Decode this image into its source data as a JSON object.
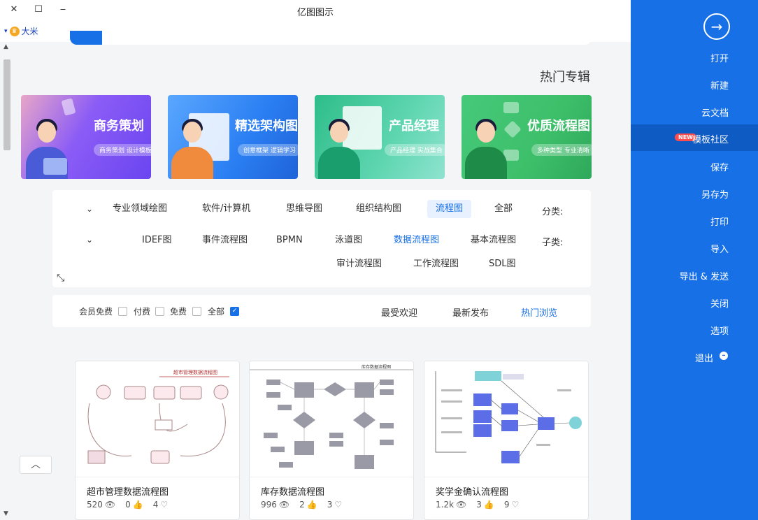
{
  "window": {
    "title": "亿图图示",
    "close_icon": "✕",
    "maximize_icon": "☐",
    "minimize_icon": "‒"
  },
  "user": {
    "name": "大米",
    "crown": "♛",
    "caret": "▾"
  },
  "section": {
    "title": "热门专辑"
  },
  "banners": [
    {
      "title": "商务策划",
      "subtitle": "商务策划 设计模板",
      "color": "#6a45f0"
    },
    {
      "title": "精选架构图",
      "subtitle": "创意框架 逻辑学习",
      "color": "#2a7ef2"
    },
    {
      "title": "产品经理",
      "subtitle": "产品经理 实战集合",
      "color": "#28c38a"
    },
    {
      "title": "优质流程图",
      "subtitle": "多种类型 专业清晰",
      "color": "#3dbf6a"
    }
  ],
  "filters": {
    "category_label": "分类:",
    "categories": [
      "全部",
      "流程图",
      "组织结构图",
      "思维导图",
      "软件/计算机",
      "专业领域绘图"
    ],
    "subcategory_label": "子类:",
    "subcategories_row1": [
      "基本流程图",
      "数据流程图",
      "泳道图",
      "BPMN",
      "事件流程图",
      "IDEF图"
    ],
    "subcategories_row2": [
      "SDL图",
      "工作流程图",
      "审计流程图"
    ],
    "chevron": "⌄",
    "expand_icon": "⤡"
  },
  "sort": {
    "tabs": [
      "热门浏览",
      "最新发布",
      "最受欢迎"
    ],
    "checkboxes": [
      "全部",
      "免费",
      "付费",
      "会员免费"
    ],
    "check_mark": "✓"
  },
  "cards": [
    {
      "title": "奖学金确认流程图",
      "views": "1.2k",
      "likes": "3",
      "favs": "9",
      "header_text": ""
    },
    {
      "title": "库存数据流程图",
      "views": "996",
      "likes": "2",
      "favs": "3",
      "header_text": "库存数据流程图"
    },
    {
      "title": "超市管理数据流程图",
      "views": "520",
      "likes": "0",
      "favs": "4",
      "header_text": "超市管理数据流程图"
    }
  ],
  "icons": {
    "views": "👁",
    "likes": "👍",
    "favs": "♡",
    "to_top": "︿",
    "open": "→"
  },
  "menu": {
    "items": [
      "打开",
      "新建",
      "云文档",
      "模板社区",
      "保存",
      "另存为",
      "打印",
      "导入",
      "导出 & 发送",
      "关闭",
      "选项",
      "退出"
    ],
    "badge": "NEW",
    "active_index": 3
  }
}
